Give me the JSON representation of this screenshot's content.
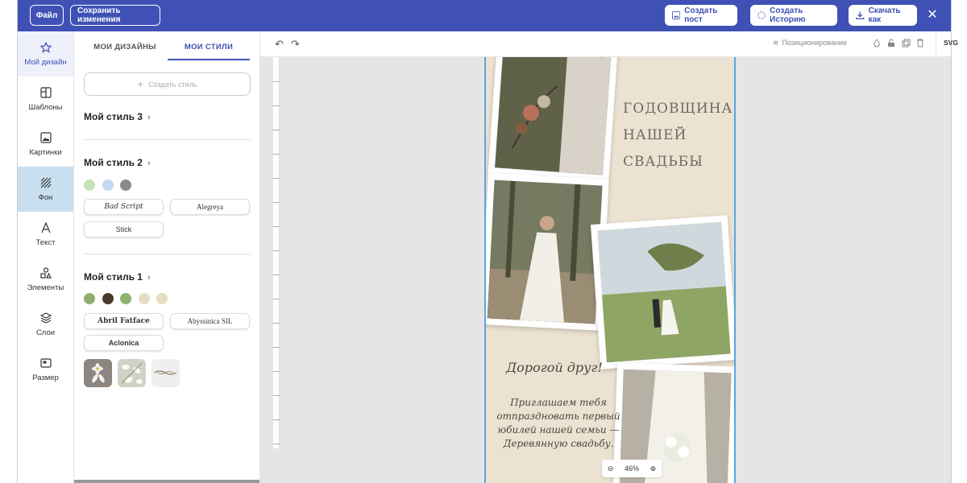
{
  "topbar": {
    "file_label": "Файл",
    "save_label": "Сохранить изменения",
    "create_post_label": "Создать пост",
    "create_story_label": "Создать Историю",
    "download_label": "Скачать как",
    "close_icon": "close-icon"
  },
  "rail": {
    "items": [
      {
        "label": "Мой дизайн",
        "icon": "star-icon"
      },
      {
        "label": "Шаблоны",
        "icon": "template-icon"
      },
      {
        "label": "Картинки",
        "icon": "image-icon"
      },
      {
        "label": "Фон",
        "icon": "background-icon"
      },
      {
        "label": "Текст",
        "icon": "text-icon"
      },
      {
        "label": "Элементы",
        "icon": "elements-icon"
      },
      {
        "label": "Слои",
        "icon": "layers-icon"
      },
      {
        "label": "Размер",
        "icon": "resize-icon"
      }
    ]
  },
  "panel": {
    "tabs": [
      "МОИ ДИЗАЙНЫ",
      "МОИ СТИЛИ"
    ],
    "create_style": "Создать стиль",
    "style3": {
      "title": "Мой стиль 3"
    },
    "style2": {
      "title": "Мой стиль 2",
      "colors": [
        "#c6e3b8",
        "#c2d9f3",
        "#8a8b8d"
      ],
      "fonts": [
        "Bad Script",
        "Alegreya",
        "Stick"
      ]
    },
    "style1": {
      "title": "Мой стиль 1",
      "colors": [
        "#8fae6f",
        "#4a3a2c",
        "#8fb26e",
        "#e6dcc4",
        "#e8dcc0"
      ],
      "fonts": [
        "Abril Fatface",
        "Abyssinica SIL",
        "Aclonica"
      ]
    }
  },
  "toolbar": {
    "positioning_label": "Позиционирование",
    "svg_label": "SVG"
  },
  "canvas": {
    "heading_lines": [
      "ГОДОВЩИНА",
      "НАШЕЙ",
      "СВАДЬБЫ"
    ],
    "greeting": "Дорогой друг!",
    "invite_lines": [
      "Приглашаем тебя",
      "отпраздновать первый",
      "юбилей нашей семьи —",
      "Деревянную свадьбу."
    ]
  },
  "zoom": {
    "value": "46%"
  }
}
